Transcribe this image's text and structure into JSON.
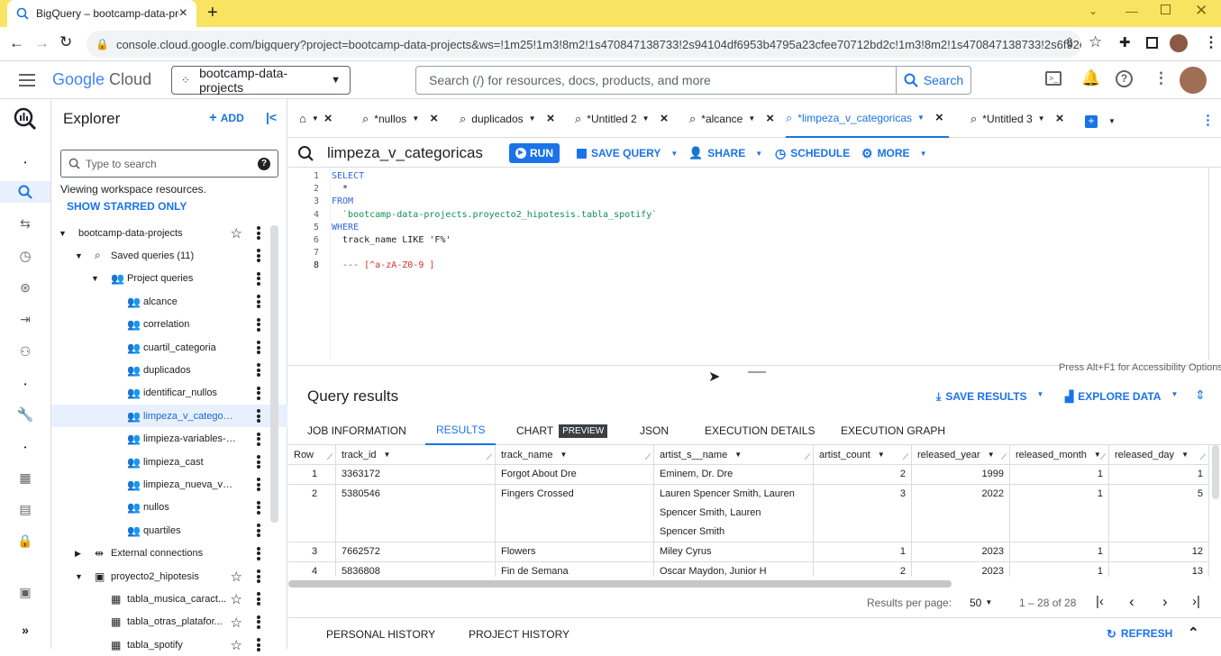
{
  "browser": {
    "tab_title": "BigQuery – bootcamp-data-proj",
    "url": "console.cloud.google.com/bigquery?project=bootcamp-data-projects&ws=!1m25!1m3!8m2!1s470847138733!2s94104df6953b4795a23cfee70712bd2c!1m3!8m2!1s470847138733!2s6f92eebf..."
  },
  "header": {
    "logo_google": "Google",
    "logo_cloud": "Cloud",
    "project": "bootcamp-data-projects",
    "search_placeholder": "Search (/) for resources, docs, products, and more",
    "search_button": "Search"
  },
  "explorer": {
    "title": "Explorer",
    "add_label": "ADD",
    "search_placeholder": "Type to search",
    "viewing_text": "Viewing workspace resources.",
    "show_starred": "SHOW STARRED ONLY",
    "tree": [
      {
        "label": "bootcamp-data-projects",
        "level": 0,
        "icon": "none",
        "expand": "down",
        "star": true
      },
      {
        "label": "Saved queries (11)",
        "level": 1,
        "icon": "query",
        "expand": "down",
        "star": false
      },
      {
        "label": "Project queries",
        "level": 2,
        "icon": "people",
        "expand": "down",
        "star": false
      },
      {
        "label": "alcance",
        "level": 3,
        "icon": "people",
        "expand": "none",
        "star": false
      },
      {
        "label": "correlation",
        "level": 3,
        "icon": "people",
        "expand": "none",
        "star": false
      },
      {
        "label": "cuartil_categoria",
        "level": 3,
        "icon": "people",
        "expand": "none",
        "star": false
      },
      {
        "label": "duplicados",
        "level": 3,
        "icon": "people",
        "expand": "none",
        "star": false
      },
      {
        "label": "identificar_nullos",
        "level": 3,
        "icon": "people",
        "expand": "none",
        "star": false
      },
      {
        "label": "limpeza_v_categoricas",
        "level": 3,
        "icon": "people",
        "expand": "none",
        "star": false,
        "selected": true
      },
      {
        "label": "limpieza-variables-nu...",
        "level": 3,
        "icon": "people",
        "expand": "none",
        "star": false
      },
      {
        "label": "limpieza_cast",
        "level": 3,
        "icon": "people",
        "expand": "none",
        "star": false
      },
      {
        "label": "limpieza_nueva_varia...",
        "level": 3,
        "icon": "people",
        "expand": "none",
        "star": false
      },
      {
        "label": "nullos",
        "level": 3,
        "icon": "people",
        "expand": "none",
        "star": false
      },
      {
        "label": "quartiles",
        "level": 3,
        "icon": "people",
        "expand": "none",
        "star": false
      },
      {
        "label": "External connections",
        "level": 1,
        "icon": "connection",
        "expand": "right",
        "star": false
      },
      {
        "label": "proyecto2_hipotesis",
        "level": 1,
        "icon": "dataset",
        "expand": "down",
        "star": true
      },
      {
        "label": "tabla_musica_caract...",
        "level": 2,
        "icon": "table",
        "expand": "none",
        "star": true
      },
      {
        "label": "tabla_otras_platafor...",
        "level": 2,
        "icon": "table",
        "expand": "none",
        "star": true
      },
      {
        "label": "tabla_spotify",
        "level": 2,
        "icon": "table",
        "expand": "none",
        "star": true
      }
    ]
  },
  "query_tabs": [
    {
      "label": "*nullos"
    },
    {
      "label": "duplicados"
    },
    {
      "label": "*Untitled 2"
    },
    {
      "label": "*alcance"
    },
    {
      "label": "*limpeza_v_categoricas",
      "active": true
    },
    {
      "label": "*Untitled 3"
    }
  ],
  "toolbar": {
    "query_name": "limpeza_v_categoricas",
    "run": "RUN",
    "save_query": "SAVE QUERY",
    "share": "SHARE",
    "schedule": "SCHEDULE",
    "more": "MORE"
  },
  "editor": {
    "lines": [
      {
        "n": "1",
        "text": "SELECT",
        "kind": "kw"
      },
      {
        "n": "2",
        "text": "  *",
        "kind": "plain"
      },
      {
        "n": "3",
        "text": "FROM",
        "kind": "kw"
      },
      {
        "n": "4",
        "text": "  `bootcamp-data-projects.proyecto2_hipotesis.tabla_spotify`",
        "kind": "str"
      },
      {
        "n": "5",
        "text": "WHERE",
        "kind": "kw"
      },
      {
        "n": "6",
        "text": "  track_name LIKE 'F%'",
        "kind": "mixed"
      },
      {
        "n": "7",
        "text": "",
        "kind": "plain"
      },
      {
        "n": "8",
        "text": "  --- [^a-zA-Z0-9 ]",
        "kind": "comment"
      }
    ],
    "accessibility_hint": "Press Alt+F1 for Accessibility Options."
  },
  "results": {
    "title": "Query results",
    "save_results": "SAVE RESULTS",
    "explore_data": "EXPLORE DATA",
    "tabs": [
      {
        "label": "JOB INFORMATION"
      },
      {
        "label": "RESULTS",
        "active": true
      },
      {
        "label": "CHART",
        "badge": "PREVIEW"
      },
      {
        "label": "JSON"
      },
      {
        "label": "EXECUTION DETAILS"
      },
      {
        "label": "EXECUTION GRAPH"
      }
    ],
    "columns": [
      "Row",
      "track_id",
      "track_name",
      "artist_s__name",
      "artist_count",
      "released_year",
      "released_month",
      "released_day"
    ],
    "rows": [
      {
        "row": "1",
        "track_id": "3363172",
        "track_name": "Forgot About Dre",
        "artists": [
          "Eminem, Dr. Dre"
        ],
        "artist_count": "2",
        "released_year": "1999",
        "released_month": "1",
        "released_day": "1"
      },
      {
        "row": "2",
        "track_id": "5380546",
        "track_name": "Fingers Crossed",
        "artists": [
          "Lauren Spencer Smith, Lauren",
          "Spencer Smith, Lauren",
          "Spencer Smith"
        ],
        "artist_count": "3",
        "released_year": "2022",
        "released_month": "1",
        "released_day": "5"
      },
      {
        "row": "3",
        "track_id": "7662572",
        "track_name": "Flowers",
        "artists": [
          "Miley Cyrus"
        ],
        "artist_count": "1",
        "released_year": "2023",
        "released_month": "1",
        "released_day": "12"
      },
      {
        "row": "4",
        "track_id": "5836808",
        "track_name": "Fin de Semana",
        "artists": [
          "Oscar Maydon, Junior H"
        ],
        "artist_count": "2",
        "released_year": "2023",
        "released_month": "1",
        "released_day": "13"
      }
    ],
    "results_per_page_label": "Results per page:",
    "results_per_page": "50",
    "range": "1 – 28 of 28",
    "refresh": "REFRESH"
  },
  "history": {
    "personal": "PERSONAL HISTORY",
    "project": "PROJECT HISTORY"
  },
  "colors": {
    "accent": "#1a73e8",
    "tabbar": "#f9e462",
    "selected_bg": "#e8f0fe"
  }
}
